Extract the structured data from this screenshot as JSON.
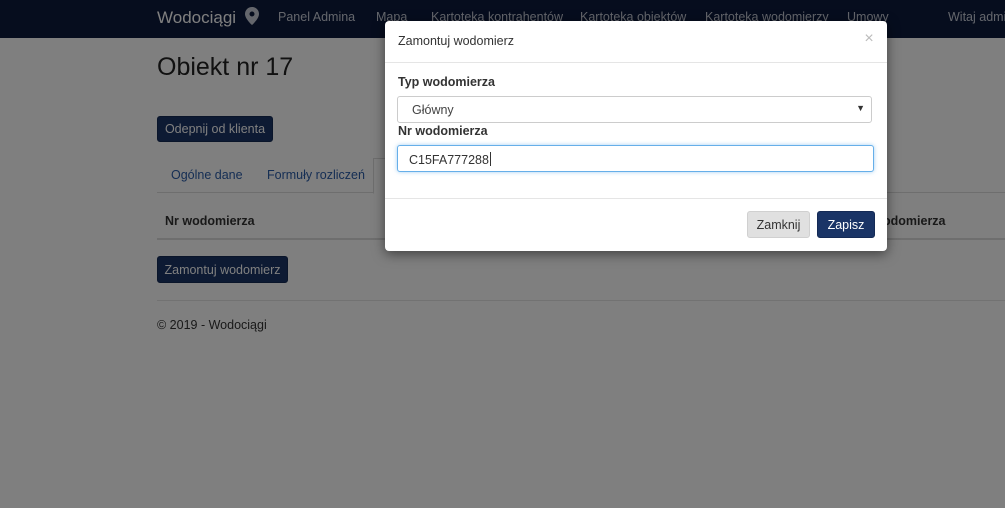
{
  "navbar": {
    "brand": "Wodociągi",
    "links": [
      "Panel Admina",
      "Mapa",
      "Kartoteka kontrahentów",
      "Kartoteka obiektów",
      "Kartoteka wodomierzy",
      "Umowy"
    ],
    "greeting": "Witaj admi",
    "brand_icon": "map-pin-icon"
  },
  "page": {
    "title": "Obiekt nr 17",
    "unpin_button": "Odepnij od klienta",
    "tabs": [
      "Ogólne dane",
      "Formuły rozliczeń"
    ],
    "table_headers": [
      "Nr wodomierza",
      "odomierza"
    ],
    "mount_button": "Zamontuj wodomierz",
    "footer": "© 2019 - Wodociągi"
  },
  "modal": {
    "title": "Zamontuj wodomierz",
    "close_glyph": "×",
    "type_label": "Typ wodomierza",
    "type_selected": "Główny",
    "number_label": "Nr wodomierza",
    "number_value": "C15FA777288",
    "close_button": "Zamknij",
    "save_button": "Zapisz"
  },
  "colors": {
    "navbar_bg": "#0c1a3c",
    "primary": "#1a3466",
    "input_focus": "#66afe9"
  }
}
